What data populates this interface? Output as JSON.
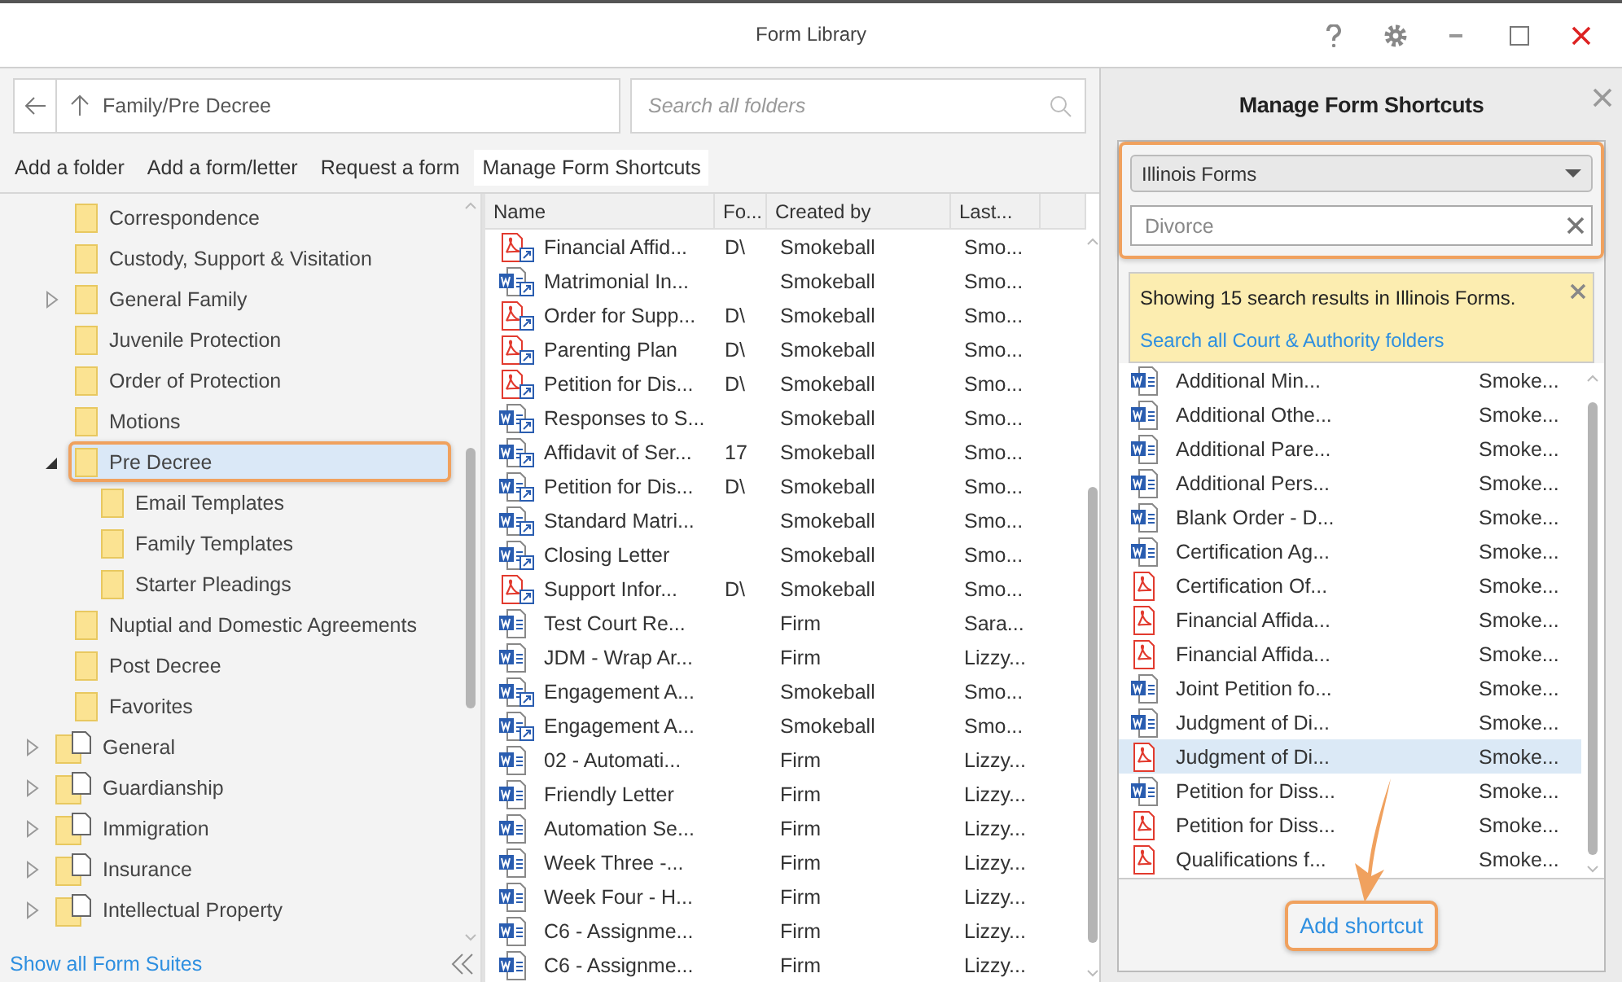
{
  "window": {
    "title": "Form Library"
  },
  "path": {
    "value": "Family/Pre Decree"
  },
  "search": {
    "placeholder": "Search all folders"
  },
  "toolbar": [
    {
      "label": "Add a folder",
      "selected": false
    },
    {
      "label": "Add a form/letter",
      "selected": false
    },
    {
      "label": "Request a form",
      "selected": false
    },
    {
      "label": "Manage Form Shortcuts",
      "selected": true
    }
  ],
  "tree": [
    {
      "children": [
        {
          "label": "Correspondence",
          "kind": "folder",
          "selected": false
        },
        {
          "label": "Custody, Support & Visitation",
          "kind": "folder",
          "selected": false
        },
        {
          "label": "General Family",
          "kind": "folder",
          "expanded": false,
          "selected": false
        },
        {
          "label": "Juvenile Protection",
          "kind": "folder",
          "selected": false
        },
        {
          "label": "Order of Protection",
          "kind": "folder",
          "selected": false
        },
        {
          "label": "Motions",
          "kind": "folder",
          "selected": false
        },
        {
          "label": "Pre Decree",
          "kind": "folder",
          "expanded": true,
          "selected": true,
          "children": [
            {
              "label": "Email Templates",
              "kind": "folder",
              "selected": false
            },
            {
              "label": "Family Templates",
              "kind": "folder",
              "selected": false
            },
            {
              "label": "Starter Pleadings",
              "kind": "folder",
              "selected": false
            }
          ]
        },
        {
          "label": "Nuptial and Domestic Agreements",
          "kind": "folder",
          "selected": false
        },
        {
          "label": "Post Decree",
          "kind": "folder",
          "selected": false
        },
        {
          "label": "Favorites",
          "kind": "folder",
          "selected": false
        }
      ]
    },
    {
      "label": "General",
      "kind": "suite",
      "expanded": false,
      "selected": false
    },
    {
      "label": "Guardianship",
      "kind": "suite",
      "expanded": false,
      "selected": false
    },
    {
      "label": "Immigration",
      "kind": "suite",
      "expanded": false,
      "selected": false
    },
    {
      "label": "Insurance",
      "kind": "suite",
      "expanded": false,
      "selected": false
    },
    {
      "label": "Intellectual Property",
      "kind": "suite",
      "expanded": false,
      "selected": false
    }
  ],
  "show_all_link": "Show all Form Suites",
  "table": {
    "columns": [
      "Name",
      "Fo...",
      "Created by",
      "Last..."
    ],
    "rows": [
      {
        "kind": "pdf-shortcut",
        "name": "Financial Affid...",
        "folder": "D\\",
        "created_by": "Smokeball",
        "last": "Smo..."
      },
      {
        "kind": "word-shortcut",
        "name": "Matrimonial In...",
        "created_by": "Smokeball",
        "last": "Smo..."
      },
      {
        "kind": "pdf-shortcut",
        "name": "Order for Supp...",
        "folder": "D\\",
        "created_by": "Smokeball",
        "last": "Smo..."
      },
      {
        "kind": "pdf-shortcut",
        "name": "Parenting Plan",
        "folder": "D\\",
        "created_by": "Smokeball",
        "last": "Smo..."
      },
      {
        "kind": "pdf-shortcut",
        "name": "Petition for Dis...",
        "folder": "D\\",
        "created_by": "Smokeball",
        "last": "Smo..."
      },
      {
        "kind": "word-shortcut",
        "name": "Responses to S...",
        "created_by": "Smokeball",
        "last": "Smo..."
      },
      {
        "kind": "word-shortcut",
        "name": "Affidavit of Ser...",
        "folder": "17",
        "created_by": "Smokeball",
        "last": "Smo..."
      },
      {
        "kind": "word-shortcut",
        "name": "Petition for Dis...",
        "folder": "D\\",
        "created_by": "Smokeball",
        "last": "Smo..."
      },
      {
        "kind": "word-shortcut",
        "name": "Standard Matri...",
        "created_by": "Smokeball",
        "last": "Smo..."
      },
      {
        "kind": "word-shortcut",
        "name": "Closing Letter",
        "created_by": "Smokeball",
        "last": "Smo..."
      },
      {
        "kind": "pdf-shortcut",
        "name": "Support Infor...",
        "folder": "D\\",
        "created_by": "Smokeball",
        "last": "Smo..."
      },
      {
        "kind": "word",
        "name": "Test Court Re...",
        "created_by": "Firm",
        "last": "Sara..."
      },
      {
        "kind": "word",
        "name": "JDM - Wrap Ar...",
        "created_by": "Firm",
        "last": "Lizzy..."
      },
      {
        "kind": "word-shortcut",
        "name": "Engagement A...",
        "created_by": "Smokeball",
        "last": "Smo..."
      },
      {
        "kind": "word-shortcut",
        "name": "Engagement A...",
        "created_by": "Smokeball",
        "last": "Smo..."
      },
      {
        "kind": "word",
        "name": "02 - Automati...",
        "created_by": "Firm",
        "last": "Lizzy..."
      },
      {
        "kind": "word",
        "name": "Friendly Letter",
        "created_by": "Firm",
        "last": "Lizzy..."
      },
      {
        "kind": "word",
        "name": "Automation Se...",
        "created_by": "Firm",
        "last": "Lizzy..."
      },
      {
        "kind": "word",
        "name": "Week Three -...",
        "created_by": "Firm",
        "last": "Lizzy..."
      },
      {
        "kind": "word",
        "name": "Week Four - H...",
        "created_by": "Firm",
        "last": "Lizzy..."
      },
      {
        "kind": "word",
        "name": "C6 - Assignme...",
        "created_by": "Firm",
        "last": "Lizzy..."
      },
      {
        "kind": "word",
        "name": "C6 - Assignme...",
        "created_by": "Firm",
        "last": "Lizzy..."
      }
    ]
  },
  "shortcuts_panel": {
    "title": "Manage Form Shortcuts",
    "suite": "Illinois Forms",
    "filter": {
      "value": "Divorce"
    },
    "notice": {
      "text": "Showing 15 search results in Illinois Forms.",
      "link": "Search all Court & Authority folders"
    },
    "results": [
      {
        "kind": "word",
        "name": "Additional Min...",
        "author": "Smoke...",
        "selected": false
      },
      {
        "kind": "word",
        "name": "Additional Othe...",
        "author": "Smoke...",
        "selected": false
      },
      {
        "kind": "word",
        "name": "Additional Pare...",
        "author": "Smoke...",
        "selected": false
      },
      {
        "kind": "word",
        "name": "Additional Pers...",
        "author": "Smoke...",
        "selected": false
      },
      {
        "kind": "word",
        "name": "Blank Order - D...",
        "author": "Smoke...",
        "selected": false
      },
      {
        "kind": "word",
        "name": "Certification Ag...",
        "author": "Smoke...",
        "selected": false
      },
      {
        "kind": "pdf",
        "name": "Certification Of...",
        "author": "Smoke...",
        "selected": false
      },
      {
        "kind": "pdf",
        "name": "Financial Affida...",
        "author": "Smoke...",
        "selected": false
      },
      {
        "kind": "pdf",
        "name": "Financial Affida...",
        "author": "Smoke...",
        "selected": false
      },
      {
        "kind": "word",
        "name": "Joint Petition fo...",
        "author": "Smoke...",
        "selected": false
      },
      {
        "kind": "word",
        "name": "Judgment of Di...",
        "author": "Smoke...",
        "selected": false
      },
      {
        "kind": "pdf",
        "name": "Judgment of Di...",
        "author": "Smoke...",
        "selected": true
      },
      {
        "kind": "word",
        "name": "Petition for Diss...",
        "author": "Smoke...",
        "selected": false
      },
      {
        "kind": "pdf",
        "name": "Petition for Diss...",
        "author": "Smoke...",
        "selected": false
      },
      {
        "kind": "pdf",
        "name": "Qualifications f...",
        "author": "Smoke...",
        "selected": false
      }
    ],
    "add_button": "Add shortcut"
  }
}
